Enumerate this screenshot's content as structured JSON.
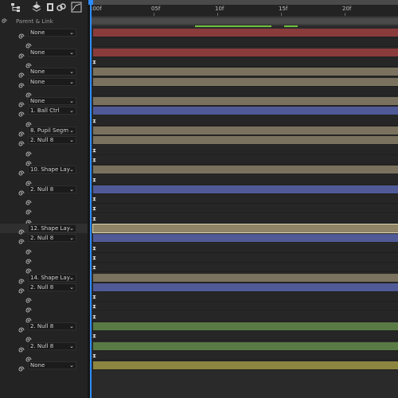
{
  "header": {
    "parent_link": "Parent & Link"
  },
  "timeline": {
    "ticks": [
      {
        "label": ":00f",
        "name": "tick-00f"
      },
      {
        "label": "05f",
        "name": "tick-05f"
      },
      {
        "label": "10f",
        "name": "tick-10f"
      },
      {
        "label": "15f",
        "name": "tick-15f"
      },
      {
        "label": "20f",
        "name": "tick-20f"
      }
    ]
  },
  "colors": {
    "red": "#8a3b3b",
    "tan": "#7a725e",
    "blue": "#4f5a96",
    "green": "#5a7a45",
    "yellow": "#8c8540",
    "sand": "#8f8466"
  },
  "rows": [
    {
      "type": "dropdown",
      "label": "None",
      "color": "red"
    },
    {
      "type": "spiral",
      "color": null
    },
    {
      "type": "dropdown",
      "label": "None",
      "color": "red"
    },
    {
      "type": "spiral",
      "color": null,
      "kf": true
    },
    {
      "type": "dropdown",
      "label": "None",
      "color": "tan"
    },
    {
      "type": "dropdown",
      "label": "None",
      "color": "tan"
    },
    {
      "type": "spiral",
      "color": null
    },
    {
      "type": "dropdown",
      "label": "None",
      "color": "tan"
    },
    {
      "type": "dropdown",
      "label": "1. Ball Ctrl",
      "color": "blue"
    },
    {
      "type": "spiral",
      "color": null,
      "kf": true
    },
    {
      "type": "dropdown",
      "label": "8. Pupil Segm",
      "color": "tan"
    },
    {
      "type": "dropdown",
      "label": "2. Null 8",
      "color": "tan"
    },
    {
      "type": "spiral",
      "color": null,
      "kf": true
    },
    {
      "type": "spiral",
      "color": null,
      "kf": true
    },
    {
      "type": "dropdown",
      "label": "10. Shape Lay",
      "color": "tan"
    },
    {
      "type": "spiral",
      "color": null,
      "kf": true
    },
    {
      "type": "dropdown",
      "label": "2. Null 8",
      "color": "blue"
    },
    {
      "type": "spiral",
      "color": null,
      "kf": true
    },
    {
      "type": "spiral",
      "color": null,
      "kf": true
    },
    {
      "type": "spiral",
      "color": null,
      "kf": true
    },
    {
      "type": "dropdown",
      "label": "12. Shape Lay",
      "color": "sand",
      "selected": true
    },
    {
      "type": "dropdown",
      "label": "2. Null 8",
      "color": "blue"
    },
    {
      "type": "spiral",
      "color": null,
      "kf": true
    },
    {
      "type": "spiral",
      "color": null,
      "kf": true
    },
    {
      "type": "spiral",
      "color": null,
      "kf": true
    },
    {
      "type": "dropdown",
      "label": "14. Shape Lay",
      "color": "tan"
    },
    {
      "type": "dropdown",
      "label": "2. Null 8",
      "color": "blue"
    },
    {
      "type": "spiral",
      "color": null,
      "kf": true
    },
    {
      "type": "spiral",
      "color": null,
      "kf": true
    },
    {
      "type": "spiral",
      "color": null,
      "kf": true
    },
    {
      "type": "dropdown",
      "label": "2. Null 8",
      "color": "green"
    },
    {
      "type": "spiral",
      "color": null,
      "kf": true
    },
    {
      "type": "dropdown",
      "label": "2. Null 8",
      "color": "green"
    },
    {
      "type": "spiral",
      "color": null,
      "kf": true
    },
    {
      "type": "dropdown",
      "label": "None",
      "color": "yellow"
    }
  ]
}
